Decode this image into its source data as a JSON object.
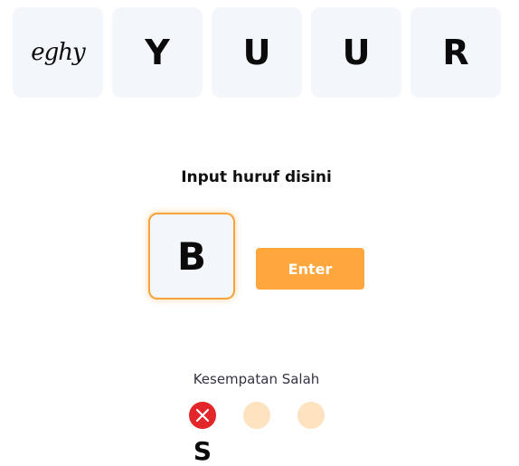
{
  "word_tiles": [
    "eghy",
    "Y",
    "U",
    "U",
    "R"
  ],
  "input": {
    "label": "Input huruf disini",
    "value": "B"
  },
  "enter_button": {
    "label": "Enter"
  },
  "chances": {
    "label": "Kesempatan Salah",
    "wrong_letters": [
      "S"
    ],
    "total": 3,
    "used": 1
  },
  "colors": {
    "accent": "#ffa63d",
    "wrong": "#e3262a",
    "empty_chance": "#ffe2bf",
    "tile_bg": "#f3f6fa"
  }
}
